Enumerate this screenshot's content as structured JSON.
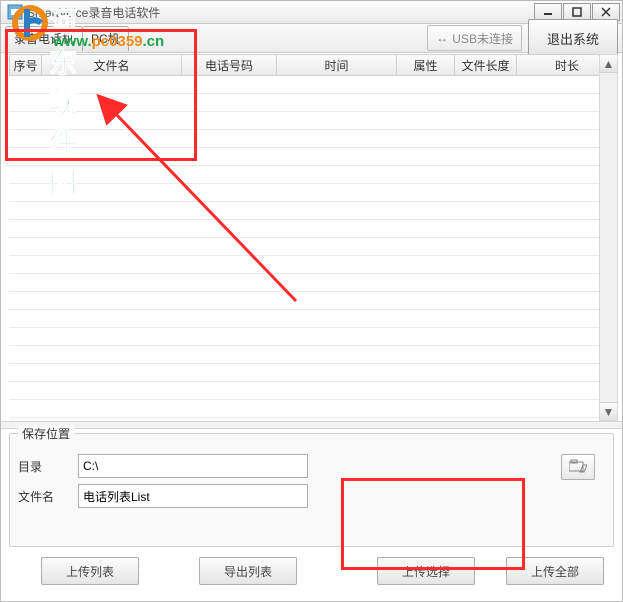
{
  "window": {
    "title": "SmartVoice录音电话软件"
  },
  "toolbar": {
    "tab_recorder": "录音电话机",
    "tab_pc": "PC机",
    "usb_status": "USB未连接",
    "exit": "退出系统"
  },
  "columns": {
    "c0": "序号",
    "c1": "文件名",
    "c2": "电话号码",
    "c3": "时间",
    "c4": "属性",
    "c5": "文件长度",
    "c6": "时长"
  },
  "save": {
    "legend": "保存位置",
    "dir_label": "目录",
    "dir_value": "C:\\",
    "file_label": "文件名",
    "file_value": "电话列表List"
  },
  "buttons": {
    "upload_list": "上传列表",
    "export_list": "导出列表",
    "upload_selected": "上传选择",
    "upload_all": "上传全部"
  },
  "watermark": {
    "site_name": "河东软件园",
    "url_prefix": "www.",
    "url_mid": "pc0359",
    "url_suffix": ".cn"
  }
}
